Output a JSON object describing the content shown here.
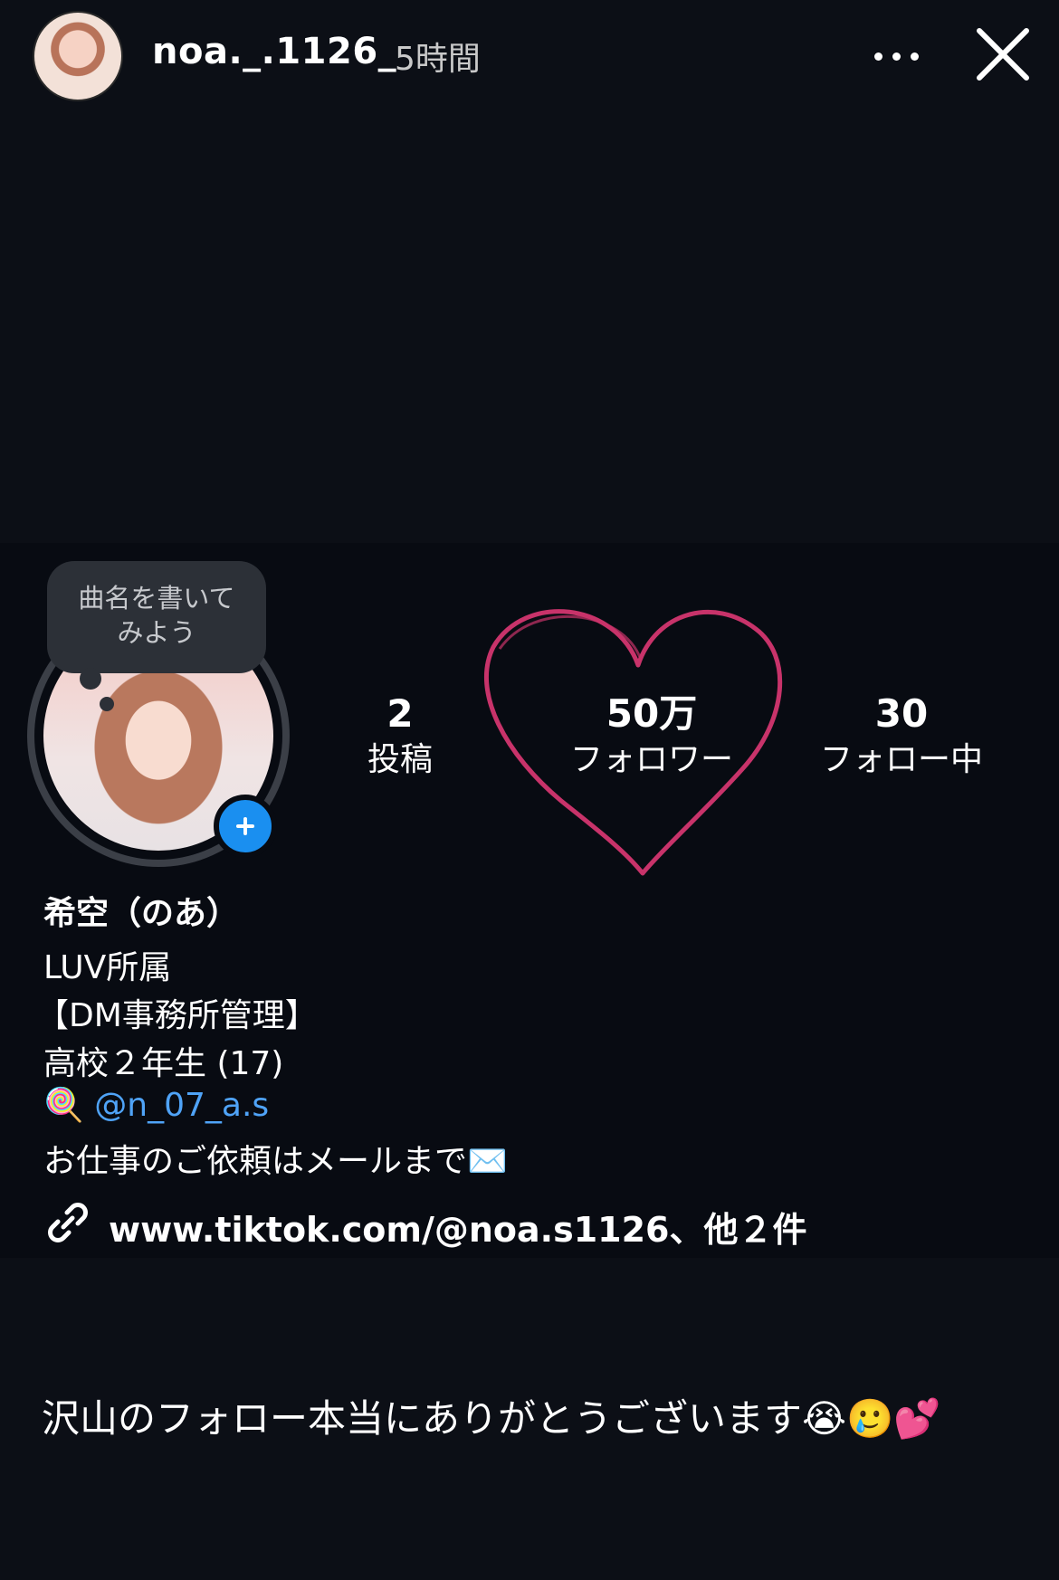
{
  "story": {
    "username": "noa._.1126_",
    "time_ago": "5時間"
  },
  "profile": {
    "song_prompt_line1": "曲名を書いて",
    "song_prompt_line2": "みよう",
    "stats": [
      {
        "value": "2",
        "label": "投稿"
      },
      {
        "value": "50万",
        "label": "フォロワー"
      },
      {
        "value": "30",
        "label": "フォロー中"
      }
    ],
    "display_name": "希空（のあ）",
    "bio": [
      "LUV所属",
      "【DM事務所管理】",
      "高校２年生 (17)",
      "@n_07_a.s",
      "お仕事のご依頼はメールまで✉️"
    ],
    "bio_emoji_prefix": "🍭",
    "link_text": "www.tiktok.com/@noa.s1126、他２件"
  },
  "caption": "沢山のフォロー本当にありがとうございます😭🥲💕",
  "colors": {
    "background": "#0c0f16",
    "card": "#080b12",
    "heart": "#c8336a",
    "mention": "#4fa3f7",
    "add_button": "#1a8ff0"
  }
}
